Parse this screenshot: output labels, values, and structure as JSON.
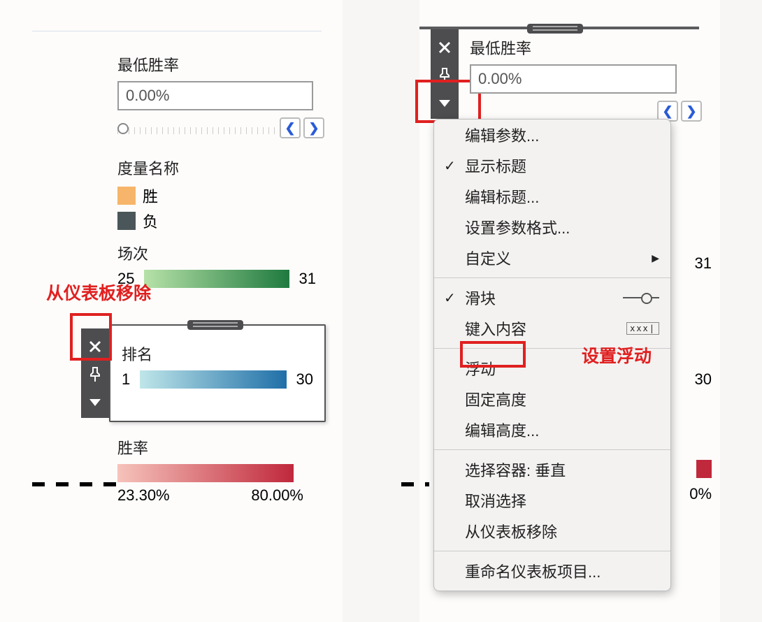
{
  "left": {
    "param": {
      "title": "最低胜率",
      "value": "0.00%"
    },
    "measure": {
      "title": "度量名称",
      "win": "胜",
      "lose": "负"
    },
    "changci": {
      "title": "场次",
      "min": "25",
      "max": "31"
    },
    "paiming": {
      "title": "排名",
      "min": "1",
      "max": "30"
    },
    "shenglv": {
      "title": "胜率",
      "min": "23.30%",
      "max": "80.00%"
    },
    "annot_remove": "从仪表板移除",
    "colors": {
      "win_swatch": "#f6b56a",
      "lose_swatch": "#4a5659",
      "changci_grad_start": "#b7e2a8",
      "changci_grad_end": "#1f7a3f",
      "paiming_grad_start": "#bfe6e9",
      "paiming_grad_end": "#1f6fa8",
      "shenglv_grad_start": "#f6c3bb",
      "shenglv_grad_end": "#c0283c"
    }
  },
  "right": {
    "param": {
      "title": "最低胜率",
      "value": "0.00%"
    },
    "changci_max": "31",
    "paiming_max": "30",
    "shenglv_max_partial": "0%",
    "annot_float": "设置浮动",
    "menu": {
      "edit_params": "编辑参数...",
      "show_title": "显示标题",
      "edit_title": "编辑标题...",
      "param_format": "设置参数格式...",
      "customize": "自定义",
      "slider": "滑块",
      "type_in": "键入内容",
      "type_glyph": "xxx|",
      "floating": "浮动",
      "fixed_height": "固定高度",
      "edit_height": "编辑高度...",
      "select_container": "选择容器: 垂直",
      "deselect": "取消选择",
      "remove": "从仪表板移除",
      "rename": "重命名仪表板项目..."
    }
  }
}
